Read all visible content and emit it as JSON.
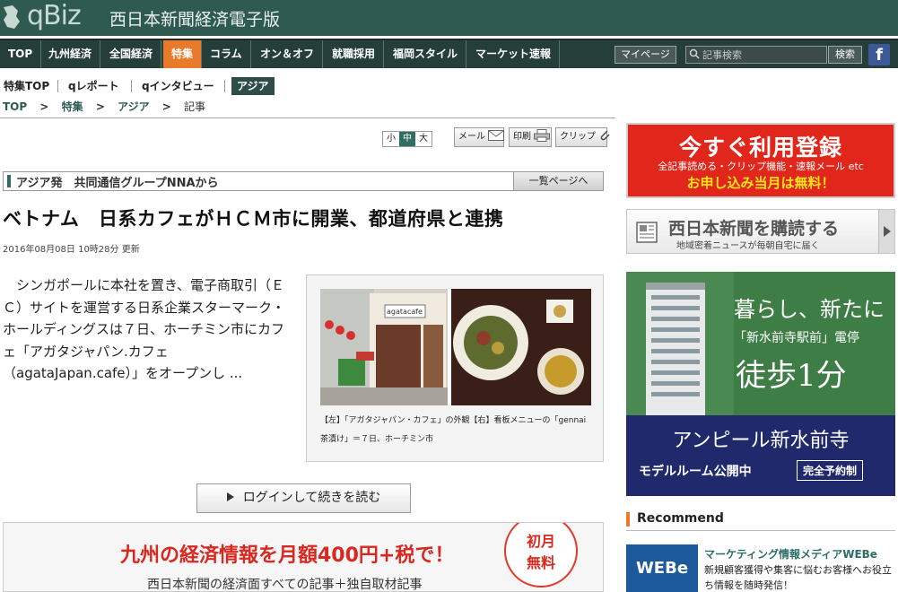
{
  "header": {
    "logo": "qBiz",
    "site_name": "西日本新聞経済電子版"
  },
  "nav": {
    "items": [
      "TOP",
      "九州経済",
      "全国経済",
      "特集",
      "コラム",
      "オン＆オフ",
      "就職採用",
      "福岡スタイル",
      "マーケット速報"
    ],
    "active": "特集",
    "mypage_label": "マイページ",
    "search_placeholder": "記事検索",
    "search_button": "検索",
    "facebook_icon": "f"
  },
  "subnav": {
    "items": [
      "特集TOP",
      "qレポート",
      "qインタビュー",
      "アジア"
    ],
    "active": "アジア"
  },
  "breadcrumb": {
    "items": [
      "TOP",
      "特集",
      "アジア"
    ],
    "separator": ">",
    "current": "記事"
  },
  "tools": {
    "sizes": [
      "小",
      "中",
      "大"
    ],
    "active_size": "中",
    "mail_label": "メール",
    "print_label": "印刷",
    "clip_label": "クリップ"
  },
  "article": {
    "category": "アジア発　共同通信グループNNAから",
    "list_link": "一覧ページへ",
    "headline": "ベトナム　日系カフェがＨＣＭ市に開業、都道府県と連携",
    "date": "2016年08月08日 10時28分 更新",
    "lead": "シンガポールに本社を置き、電子商取引（ＥＣ）サイトを運営する日系企業スターマーク・ホールディングスは７日、ホーチミン市にカフェ「アガタジャパン.カフェ（agataJapan.cafe）」をオープンし ...",
    "caption": "【左】「アガタジャパン・カフェ」の外観【右】看板メニューの「gennai茶漬け」＝７日、ホーチミン市",
    "photo_sign": "agatacafe",
    "login_button": "ログインして続きを読む"
  },
  "promo": {
    "main": "九州の経済情報を月額400円+税で！",
    "sub": "西日本新聞の経済面すべての記事＋独自取材記事",
    "badge_line1": "初月",
    "badge_line2": "無料"
  },
  "sidebar": {
    "signup": {
      "title": "今すぐ利用登録",
      "sub": "全記事読める・クリップ機能・速報メール etc",
      "cta": "お申し込み当月は無料！"
    },
    "subscribe": {
      "title": "西日本新聞を購読する",
      "sub": "地域密着ニュースが毎朝自宅に届く"
    },
    "condo_ad": {
      "line1": "暮らし、新たに",
      "line2": "「新水前寺駅前」電停",
      "line3": "徒歩1分",
      "line4": "アンピール新水前寺",
      "line5": "モデルルーム公開中",
      "line6": "完全予約制"
    },
    "recommend": {
      "heading": "Recommend",
      "items": [
        {
          "thumb": "WEBe",
          "title": "マーケティング情報メディアWEBe",
          "desc": "新規顧客獲得や集客に悩むお客様へお役立ち情報を随時発信！"
        }
      ]
    }
  },
  "colors": {
    "header_bg": "#2f5a52",
    "nav_bg": "#263e3a",
    "accent": "#e87a2a",
    "link_green": "#2d5b52",
    "promo_red": "#d9281f"
  }
}
